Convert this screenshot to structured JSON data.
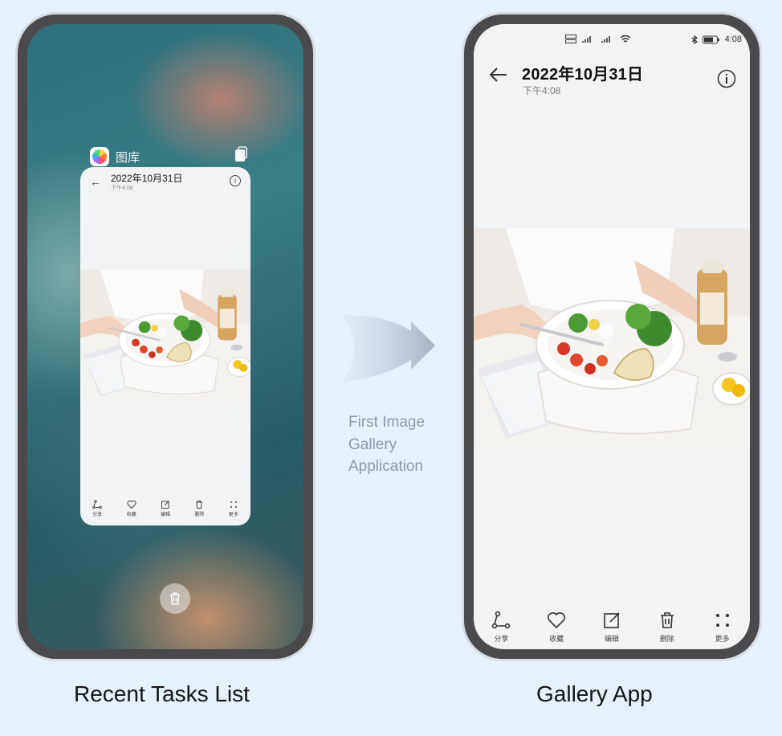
{
  "recent_tasks": {
    "app_name": "图库",
    "card": {
      "date": "2022年10月31日",
      "time": "下午4:08",
      "toolbar": [
        {
          "icon": "share-icon",
          "label": "分享"
        },
        {
          "icon": "heart-icon",
          "label": "收藏"
        },
        {
          "icon": "edit-icon",
          "label": "编辑"
        },
        {
          "icon": "trash-icon",
          "label": "删除"
        },
        {
          "icon": "more-icon",
          "label": "更多"
        }
      ]
    }
  },
  "arrow_caption": [
    "First Image",
    "Gallery",
    "Application"
  ],
  "gallery": {
    "status_time": "4:08",
    "date": "2022年10月31日",
    "time": "下午4:08",
    "toolbar": [
      {
        "icon": "share-icon",
        "label": "分享"
      },
      {
        "icon": "heart-icon",
        "label": "收藏"
      },
      {
        "icon": "edit-icon",
        "label": "编辑"
      },
      {
        "icon": "trash-icon",
        "label": "删除"
      },
      {
        "icon": "more-icon",
        "label": "更多"
      }
    ]
  },
  "captions": {
    "left": "Recent Tasks List",
    "right": "Gallery App"
  },
  "colors": {
    "background": "#e6f1fb",
    "phone_frame": "#4a4a4c",
    "screen": "#f2f3f5"
  }
}
